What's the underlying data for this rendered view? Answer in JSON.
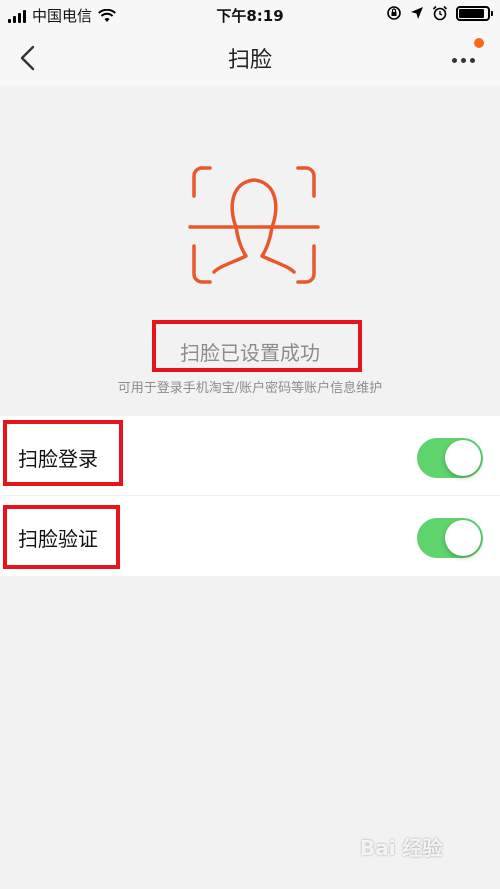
{
  "status_bar": {
    "carrier": "中国电信",
    "time": "下午8:19",
    "battery_level": 0.9
  },
  "nav": {
    "title": "扫脸",
    "has_notification": true
  },
  "face_icon": {
    "color": "#e8582b"
  },
  "status": {
    "title": "扫脸已设置成功",
    "description": "可用于登录手机淘宝/账户密码等账户信息维护"
  },
  "settings": [
    {
      "label": "扫脸登录",
      "enabled": true
    },
    {
      "label": "扫脸验证",
      "enabled": true
    }
  ],
  "colors": {
    "accent": "#ff6a1a",
    "toggle_on": "#5fd36c",
    "highlight": "#e8141b"
  },
  "watermark": "Bai 经验"
}
